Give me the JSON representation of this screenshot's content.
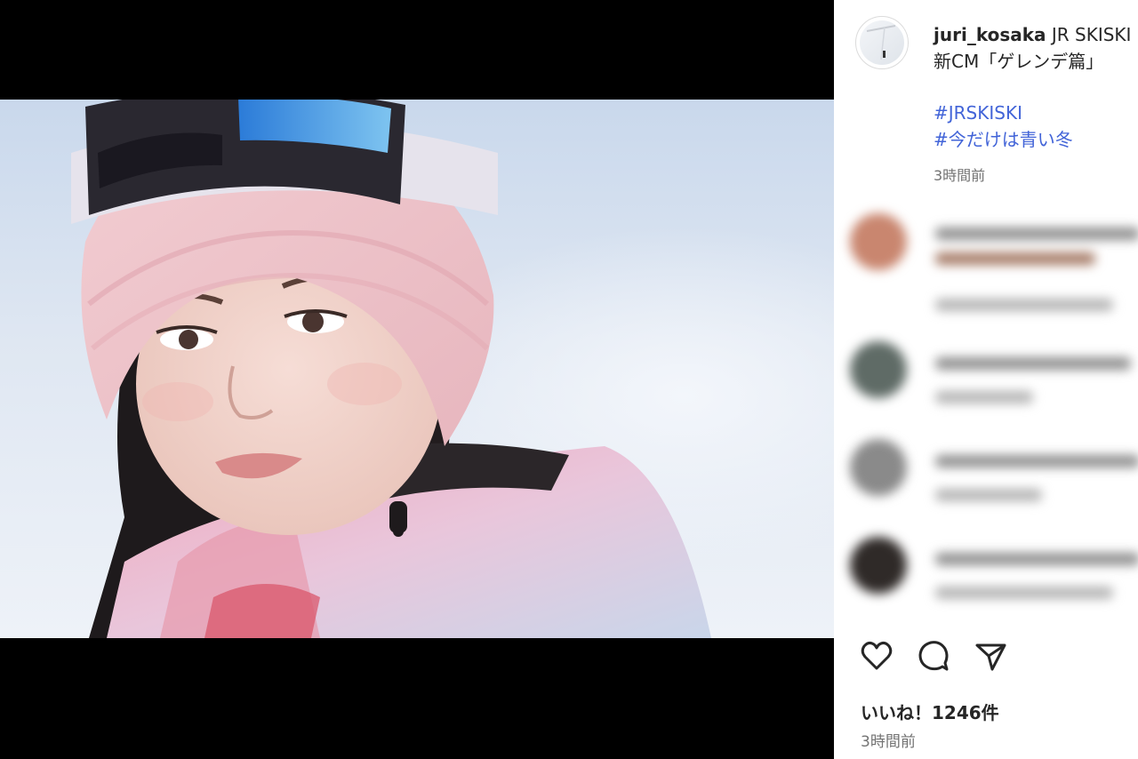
{
  "post": {
    "username": "juri_kosaka",
    "caption_text": "JR SKISKI",
    "caption_line2": "新CM「ゲレンデ篇」",
    "hashtags": [
      "#JRSKISKI",
      "#今だけは青い冬"
    ],
    "caption_time": "3時間前",
    "likes": "いいね！1246件",
    "posted_time": "3時間前"
  },
  "icons": {
    "mute": "volume-muted-icon",
    "like": "heart-icon",
    "comment": "comment-bubble-icon",
    "share": "send-paper-plane-icon"
  },
  "colors": {
    "hashtag": "#4264d8",
    "secondary_text": "#737373",
    "video_background": "#000000"
  }
}
